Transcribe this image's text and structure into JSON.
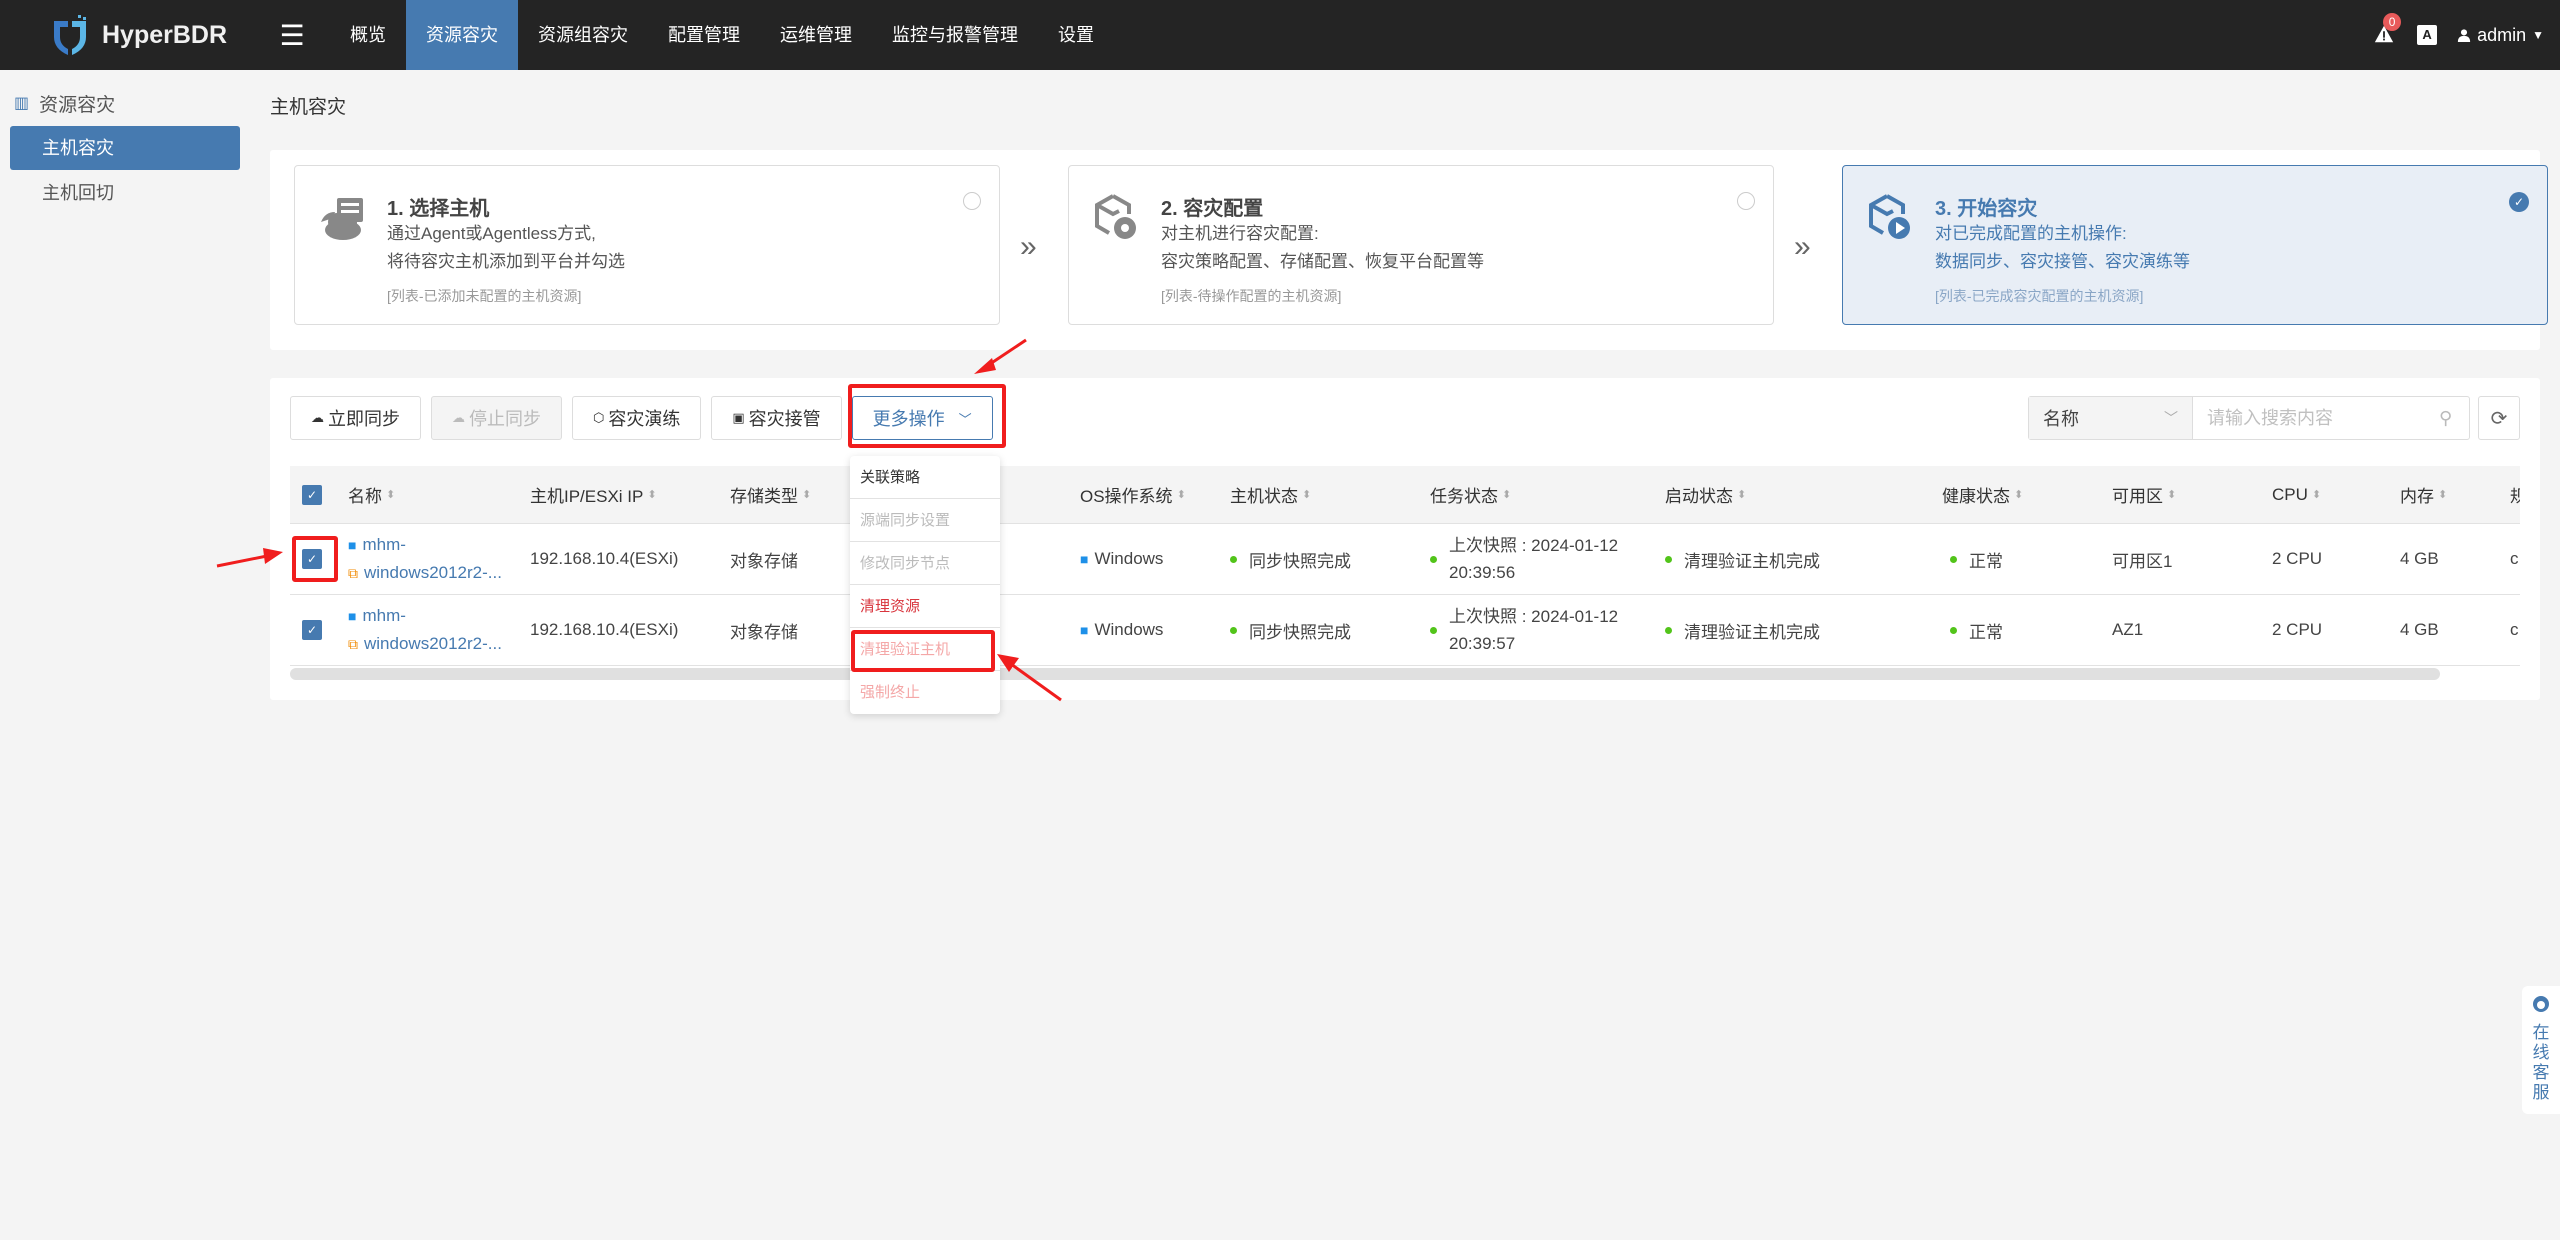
{
  "app": {
    "name": "HyperBDR"
  },
  "topnav": {
    "items": [
      "概览",
      "资源容灾",
      "资源组容灾",
      "配置管理",
      "运维管理",
      "监控与报警管理",
      "设置"
    ],
    "active_index": 1,
    "alert_count": "0",
    "lang_icon_text": "A",
    "user": "admin"
  },
  "sidebar": {
    "section_title": "资源容灾",
    "items": [
      {
        "label": "主机容灾",
        "active": true
      },
      {
        "label": "主机回切",
        "active": false
      }
    ]
  },
  "page": {
    "title": "主机容灾"
  },
  "steps": [
    {
      "title": "1. 选择主机",
      "desc1": "通过Agent或Agentless方式,",
      "desc2": "将待容灾主机添加到平台并勾选",
      "note": "[列表-已添加未配置的主机资源]",
      "selected": false
    },
    {
      "title": "2. 容灾配置",
      "desc1": "对主机进行容灾配置:",
      "desc2": "容灾策略配置、存储配置、恢复平台配置等",
      "note": "[列表-待操作配置的主机资源]",
      "selected": false
    },
    {
      "title": "3. 开始容灾",
      "desc1": "对已完成配置的主机操作:",
      "desc2": "数据同步、容灾接管、容灾演练等",
      "note": "[列表-已完成容灾配置的主机资源]",
      "selected": true
    }
  ],
  "toolbar": {
    "sync_now": "立即同步",
    "stop_sync": "停止同步",
    "dr_drill": "容灾演练",
    "dr_takeover": "容灾接管",
    "more_actions": "更多操作"
  },
  "search": {
    "field": "名称",
    "placeholder": "请输入搜索内容"
  },
  "more_menu": [
    {
      "label": "关联策略",
      "state": "enabled"
    },
    {
      "label": "源端同步设置",
      "state": "disabled"
    },
    {
      "label": "修改同步节点",
      "state": "disabled"
    },
    {
      "label": "清理资源",
      "state": "danger"
    },
    {
      "label": "清理验证主机",
      "state": "danger-disabled"
    },
    {
      "label": "强制终止",
      "state": "danger-disabled"
    }
  ],
  "table": {
    "columns": [
      "名称",
      "主机IP/ESXi IP",
      "存储类型",
      "OS操作系统",
      "主机状态",
      "任务状态",
      "启动状态",
      "健康状态",
      "可用区",
      "CPU",
      "内存",
      "规"
    ],
    "rows": [
      {
        "checked": true,
        "name1": "mhm-",
        "name2": "windows2012r2-...",
        "ip": "192.168.10.4(ESXi)",
        "storage": "对象存储",
        "os": "Windows",
        "host_status": "同步快照完成",
        "task1": "上次快照 : 2024-01-12",
        "task2": "20:39:56",
        "boot_status": "清理验证主机完成",
        "health": "正常",
        "zone": "可用区1",
        "cpu": "2 CPU",
        "mem": "4 GB",
        "spec": "c"
      },
      {
        "checked": true,
        "name1": "mhm-",
        "name2": "windows2012r2-...",
        "ip": "192.168.10.4(ESXi)",
        "storage": "对象存储",
        "os": "Windows",
        "host_status": "同步快照完成",
        "task1": "上次快照 : 2024-01-12",
        "task2": "20:39:57",
        "boot_status": "清理验证主机完成",
        "health": "正常",
        "zone": "AZ1",
        "cpu": "2 CPU",
        "mem": "4 GB",
        "spec": "c"
      }
    ]
  },
  "online_service": "在线客服",
  "colors": {
    "accent": "#467ab0",
    "topbar": "#242424",
    "success": "#52c41a",
    "danger": "#d9363e",
    "annotation": "#f01d1d"
  }
}
